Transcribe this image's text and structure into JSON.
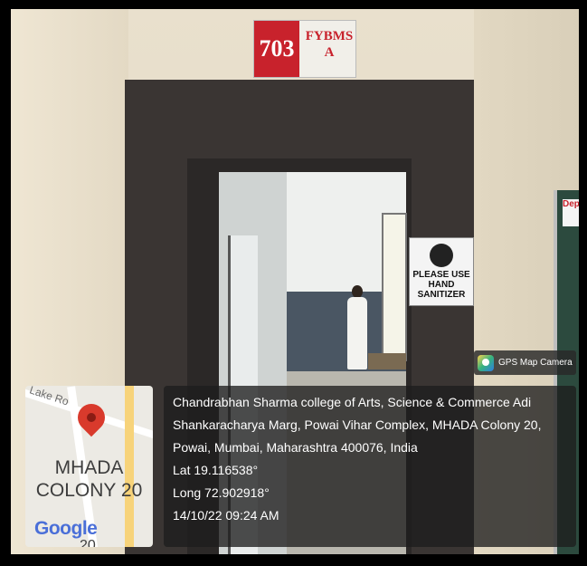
{
  "room_sign": {
    "number": "703",
    "class_line1": "FYBMS",
    "class_line2": "A"
  },
  "notice": {
    "line1": "PLEASE USE",
    "line2": "HAND SANITIZER"
  },
  "board_label": "Dep",
  "gps_app": {
    "label": "GPS Map Camera",
    "icon": "gps-map-camera-icon"
  },
  "map": {
    "road_label": "Lake Ro",
    "area_line1": "MHADA",
    "area_line2": "COLONY 20",
    "logo": "Google",
    "partial_number": "20",
    "pin_icon": "location-pin-icon",
    "pin_color": "#d93a2c"
  },
  "location": {
    "address_line1": "Chandrabhan Sharma college of Arts, Science & Commerce Adi",
    "address_line2": "Shankaracharya Marg, Powai Vihar Complex, MHADA Colony 20,",
    "address_line3": "Powai, Mumbai, Maharashtra 400076, India",
    "latitude": "Lat 19.116538°",
    "longitude": "Long 72.902918°",
    "datetime": "14/10/22 09:24 AM"
  }
}
